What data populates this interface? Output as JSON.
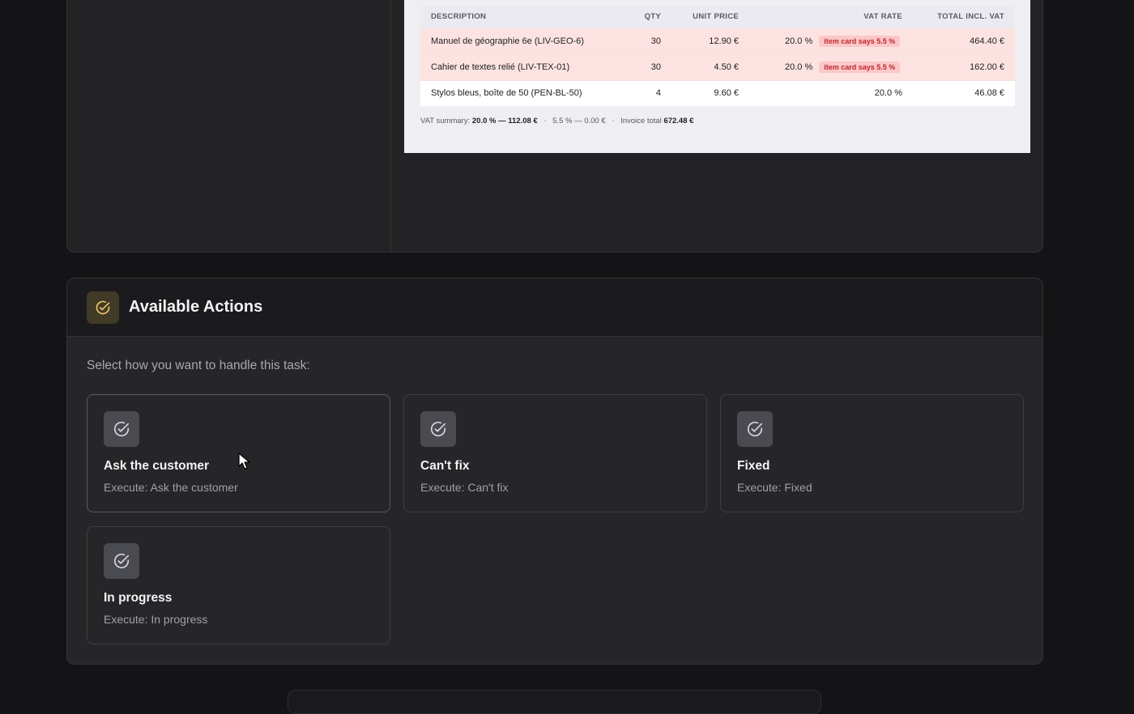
{
  "invoice": {
    "columns": {
      "description": "DESCRIPTION",
      "qty": "QTY",
      "unit_price": "UNIT PRICE",
      "vat_rate": "VAT RATE",
      "total": "TOTAL INCL. VAT"
    },
    "rows": [
      {
        "description": "Manuel de géographie 6e (LIV-GEO-6)",
        "qty": "30",
        "unit_price": "12.90 €",
        "vat_rate": "20.0 %",
        "flag": "item card says 5.5 %",
        "total": "464.40 €"
      },
      {
        "description": "Cahier de textes relié (LIV-TEX-01)",
        "qty": "30",
        "unit_price": "4.50 €",
        "vat_rate": "20.0 %",
        "flag": "item card says 5.5 %",
        "total": "162.00 €"
      },
      {
        "description": "Stylos bleus, boîte de 50 (PEN-BL-50)",
        "qty": "4",
        "unit_price": "9.60 €",
        "vat_rate": "20.0 %",
        "total": "46.08 €"
      }
    ],
    "summary": {
      "label": "VAT summary:",
      "rate_20": "20.0 % — 112.08 €",
      "rate_55": "5.5 % — 0.00 €",
      "total_label": "Invoice total",
      "total_value": "672.48 €",
      "separator": "·"
    }
  },
  "actions": {
    "title": "Available Actions",
    "subtitle": "Select how you want to handle this task:",
    "items": [
      {
        "title": "Ask the customer",
        "desc": "Execute: Ask the customer"
      },
      {
        "title": "Can't fix",
        "desc": "Execute: Can't fix"
      },
      {
        "title": "Fixed",
        "desc": "Execute: Fixed"
      },
      {
        "title": "In progress",
        "desc": "Execute: In progress"
      }
    ]
  },
  "colors": {
    "accent_icon": "#e9c46a",
    "flag_bg": "#fde2e2",
    "flag_text": "#c0262d"
  },
  "icons": {
    "header": "check-circle-icon",
    "tile": "check-circle-icon"
  }
}
